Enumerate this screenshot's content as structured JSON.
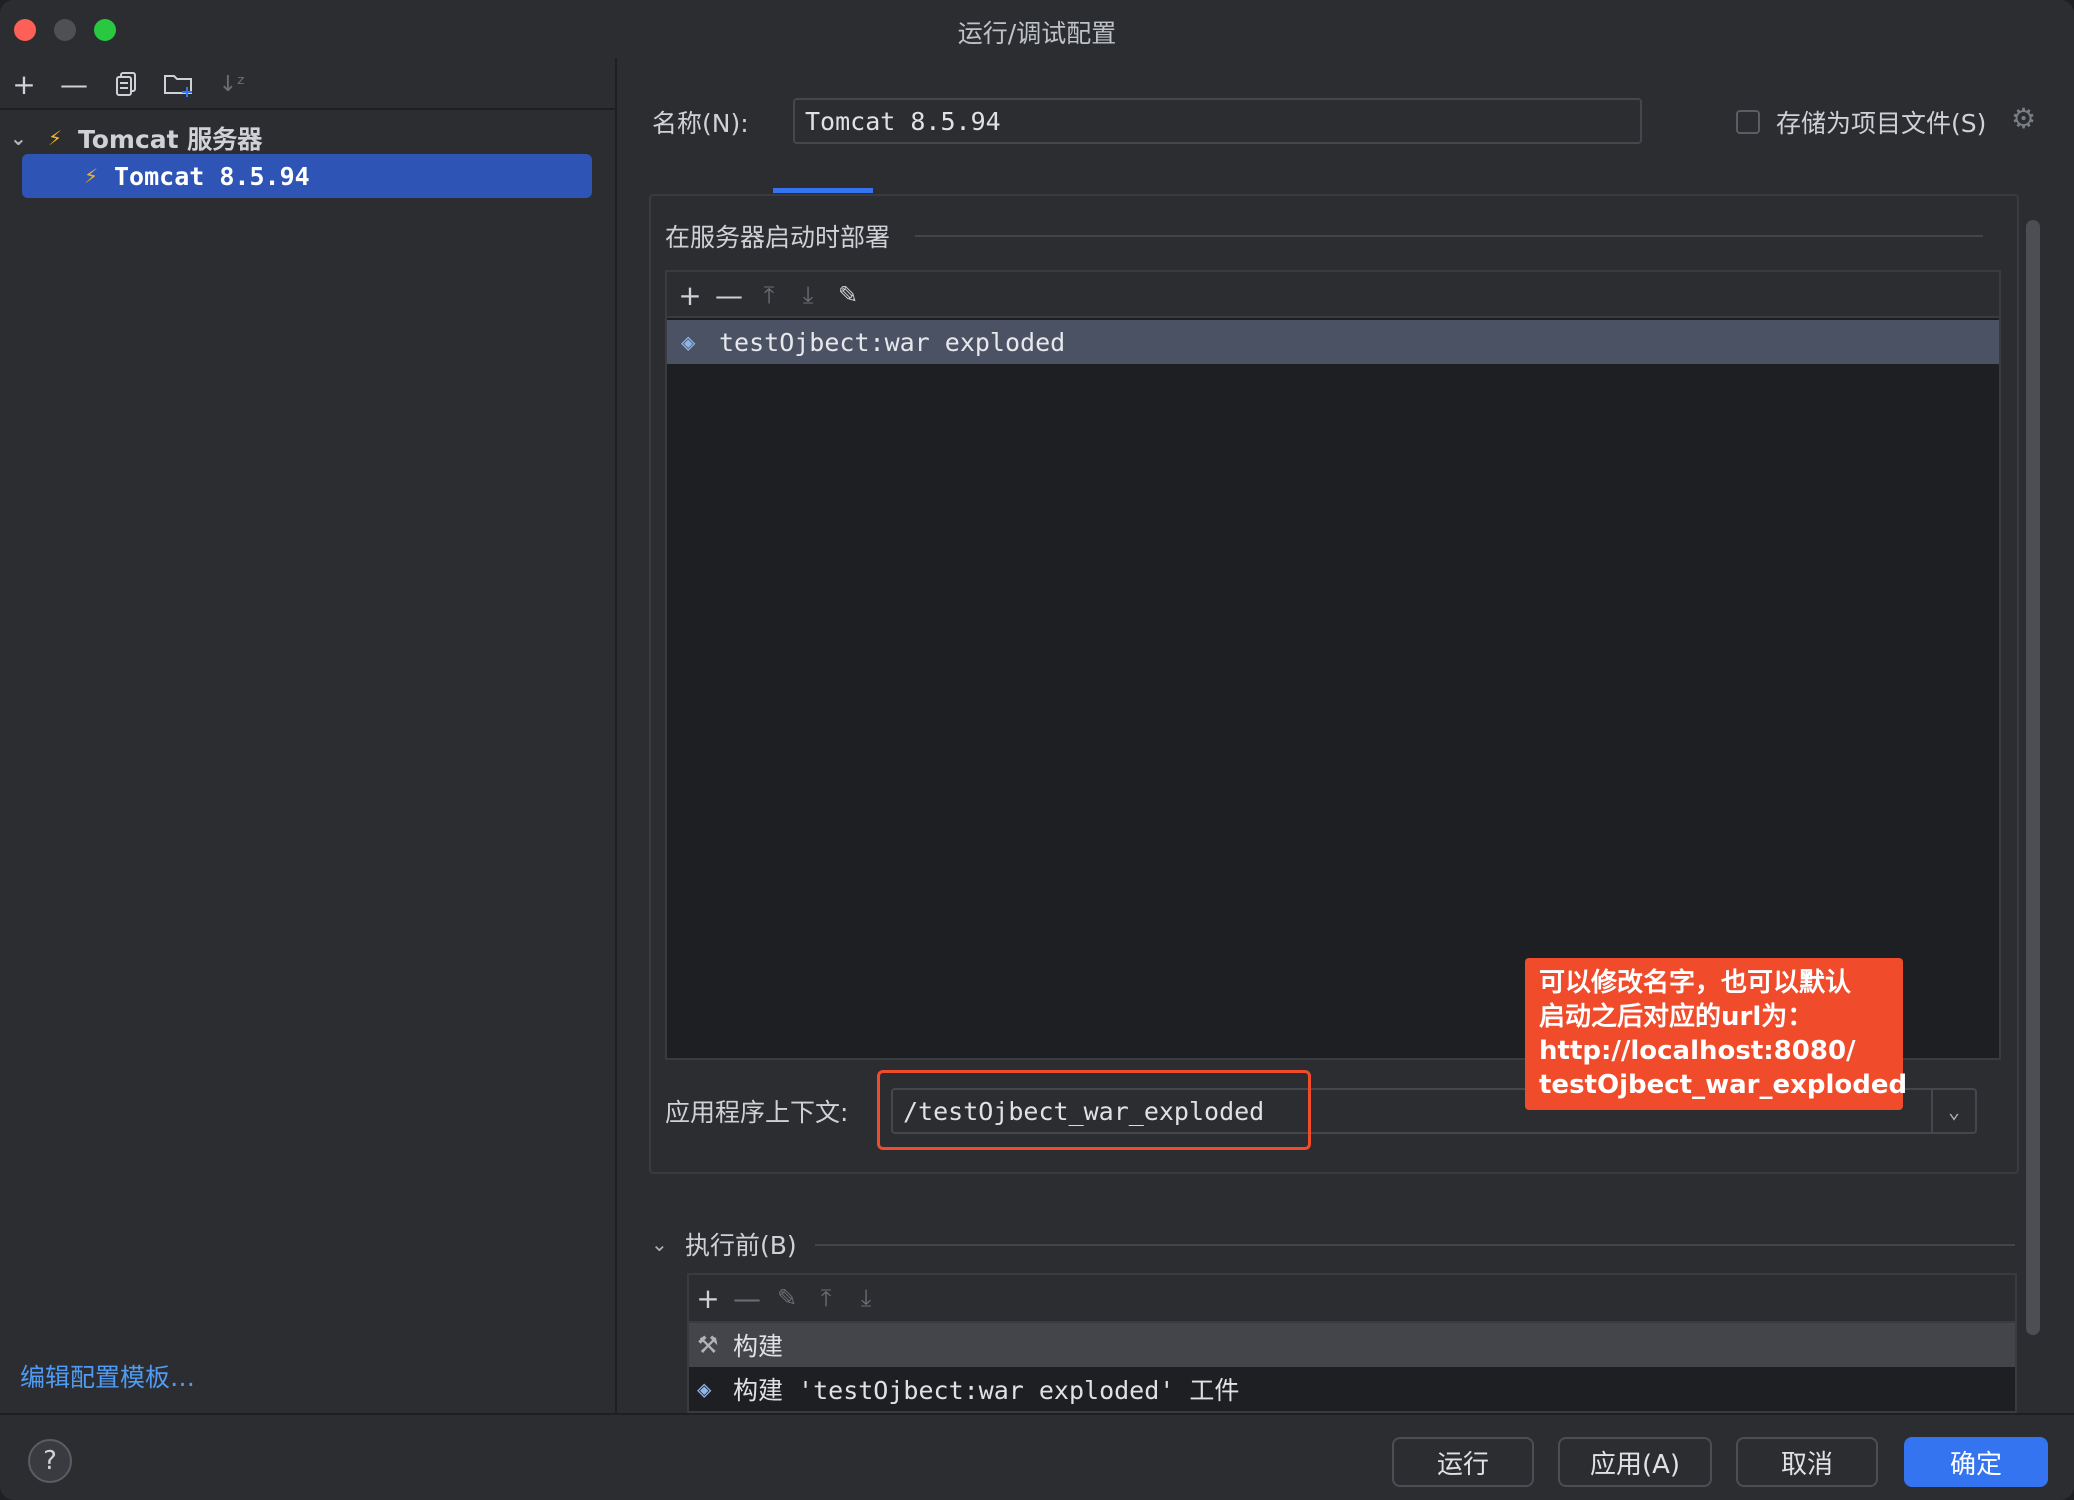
{
  "window": {
    "title": "运行/调试配置"
  },
  "left_toolbar": {
    "icons": [
      "add-icon",
      "remove-icon",
      "copy-icon",
      "new-folder-icon",
      "sort-icon"
    ]
  },
  "tree": {
    "group_label": "Tomcat 服务器",
    "selected_item": "Tomcat 8.5.94"
  },
  "edit_templates_link": "编辑配置模板…",
  "form": {
    "name_label": "名称(N):",
    "name_value": "Tomcat 8.5.94",
    "store_label": "存储为项目文件(S)",
    "store_checked": false
  },
  "deploy": {
    "section_title": "在服务器启动时部署",
    "artifacts": [
      "testOjbect:war exploded"
    ],
    "context_label": "应用程序上下文:",
    "context_value": "/testOjbect_war_exploded"
  },
  "callout": {
    "lines": [
      "可以修改名字，也可以默认",
      "启动之后对应的url为：",
      "http://localhost:8080/",
      "testOjbect_war_exploded"
    ]
  },
  "before_launch": {
    "title": "执行前(B)",
    "tasks": [
      "构建",
      "构建 'testOjbect:war exploded' 工件"
    ]
  },
  "buttons": {
    "run": "运行",
    "apply": "应用(A)",
    "cancel": "取消",
    "ok": "确定",
    "help": "?"
  },
  "colors": {
    "accent": "#3574f0",
    "selection": "#2e55b6",
    "callout": "#f04b2b",
    "link": "#4f9bf5"
  }
}
